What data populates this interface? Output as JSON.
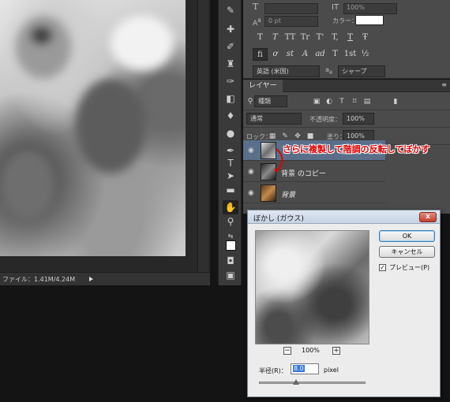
{
  "status_bar": {
    "file_info": "ファイル：1.41M/4.24M"
  },
  "character_panel": {
    "size_value": "0 pt",
    "tracking_value": "100%",
    "color_label": "カラー：",
    "glyphs": [
      "T",
      "T",
      "TT",
      "Tr",
      "T'",
      "T,",
      "T",
      "Ŧ"
    ],
    "ot_glyphs": [
      "fi",
      "ơ",
      "st",
      "A",
      "ad",
      "T",
      "1st",
      "½"
    ],
    "language": "英語 (米国)",
    "antialias": "シャープ"
  },
  "layers_panel": {
    "tab_label": "レイヤー",
    "filter_label": "種類",
    "blend_mode": "通常",
    "opacity_label": "不透明度：",
    "opacity_value": "100%",
    "lock_label": "ロック：",
    "fill_label": "塗り：",
    "fill_value": "100%",
    "layers": [
      {
        "name": "",
        "selected": true
      },
      {
        "name": "背景 のコピー",
        "selected": false
      },
      {
        "name": "背景",
        "selected": false
      }
    ]
  },
  "annotation": "さらに複製して階調の反転してぼかす",
  "blur_dialog": {
    "title": "ぼかし (ガウス)",
    "ok_label": "OK",
    "cancel_label": "キャンセル",
    "preview_label": "プレビュー(P)",
    "preview_checked": "✓",
    "zoom_out": "−",
    "zoom_level": "100%",
    "zoom_in": "+",
    "radius_label": "半径(R)：",
    "radius_value": "8.0",
    "radius_unit": "pixel",
    "close_label": "x"
  }
}
